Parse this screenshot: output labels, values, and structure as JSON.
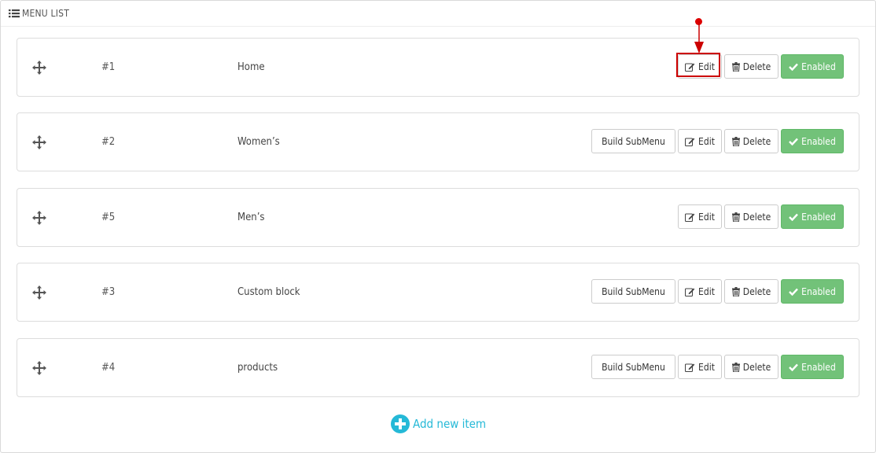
{
  "panel": {
    "title": "MENU LIST",
    "title_icon": "list-icon"
  },
  "items": [
    {
      "id": "#1",
      "name": "Home",
      "has_submenu": false
    },
    {
      "id": "#2",
      "name": "Women’s",
      "has_submenu": true
    },
    {
      "id": "#5",
      "name": "Men’s",
      "has_submenu": false
    },
    {
      "id": "#3",
      "name": "Custom block",
      "has_submenu": true
    },
    {
      "id": "#4",
      "name": "products",
      "has_submenu": true
    }
  ],
  "actions": {
    "build_submenu": "Build SubMenu",
    "edit": "Edit",
    "delete": "Delete",
    "enabled": "Enabled"
  },
  "icons": {
    "move": "move-icon",
    "edit": "edit-icon",
    "delete": "trash-icon",
    "enabled": "check-icon",
    "add": "plus-circle-icon"
  },
  "add_new": {
    "label": "Add new item"
  },
  "colors": {
    "enabled_bg": "#72c279",
    "link": "#25b9d7",
    "annotation": "#cc0000"
  }
}
